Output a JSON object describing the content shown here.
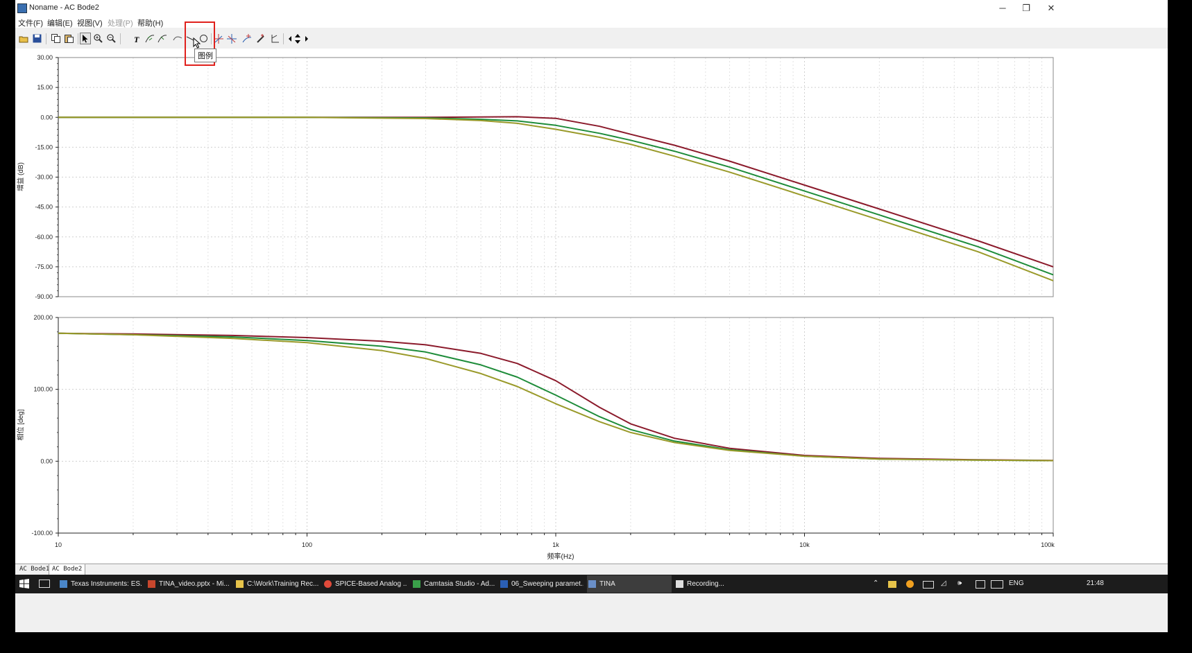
{
  "window": {
    "title": "Noname - AC Bode2",
    "controls": [
      "─",
      "❐",
      "✕"
    ]
  },
  "menu": [
    {
      "label": "文件(F)",
      "enabled": true
    },
    {
      "label": "编辑(E)",
      "enabled": true
    },
    {
      "label": "视图(V)",
      "enabled": true
    },
    {
      "label": "处理(P)",
      "enabled": false
    },
    {
      "label": "帮助(H)",
      "enabled": true
    }
  ],
  "toolbar": {
    "buttons": [
      "open-icon",
      "save-icon",
      "copy-icon",
      "paste-icon",
      "pointer-icon",
      "zoom-in-icon",
      "zoom-out-icon",
      "text-icon",
      "curve-label-icon",
      "curve-label-alt-icon",
      "legend-icon",
      "line-icon",
      "circle-icon",
      "cursor-a-icon",
      "cursor-b-icon",
      "marker-icon",
      "pen-icon",
      "axis-icon",
      "move-left-icon",
      "move-updown-icon",
      "move-right-icon"
    ],
    "tooltip": "图例"
  },
  "highlight_color": "#e0201c",
  "chart_data": [
    {
      "type": "line",
      "name": "gain",
      "ylabel": "增益 (dB)",
      "x_scale": "log",
      "xlim": [
        10,
        100000
      ],
      "ylim": [
        -90,
        30
      ],
      "yticks": [
        30,
        15,
        0,
        -15,
        -30,
        -45,
        -60,
        -75,
        -90
      ],
      "ytick_labels": [
        "30.00",
        "15.00",
        "0.00",
        "-15.00",
        "-30.00",
        "-45.00",
        "-60.00",
        "-75.00",
        "-90.00"
      ],
      "x": [
        10,
        100,
        300,
        500,
        700,
        1000,
        1500,
        2000,
        3000,
        5000,
        10000,
        20000,
        50000,
        100000
      ],
      "series": [
        {
          "color": "#8b1a2b",
          "values": [
            0,
            0,
            0,
            0.2,
            0.3,
            -0.5,
            -4.5,
            -8.5,
            -14,
            -22,
            -34,
            -46,
            -62,
            -75
          ]
        },
        {
          "color": "#1e8c3a",
          "values": [
            0,
            0,
            -0.3,
            -1,
            -1.8,
            -4,
            -8,
            -11.5,
            -17,
            -25,
            -37,
            -49,
            -65,
            -79
          ]
        },
        {
          "color": "#9a9a2a",
          "values": [
            0,
            0,
            -0.6,
            -1.6,
            -3,
            -6,
            -10,
            -13.5,
            -19.5,
            -27.5,
            -39.5,
            -51.5,
            -67.5,
            -82
          ]
        }
      ]
    },
    {
      "type": "line",
      "name": "phase",
      "ylabel": "相位 [deg]",
      "xlabel": "频率(Hz)",
      "x_scale": "log",
      "xlim": [
        10,
        100000
      ],
      "ylim": [
        -100,
        200
      ],
      "yticks": [
        200,
        100,
        0,
        -100
      ],
      "ytick_labels": [
        "200.00",
        "100.00",
        "0.00",
        "-100.00"
      ],
      "xticks": [
        10,
        100,
        1000,
        10000,
        100000
      ],
      "xtick_labels": [
        "10",
        "100",
        "1k",
        "10k",
        "100k"
      ],
      "x": [
        10,
        20,
        50,
        100,
        200,
        300,
        500,
        700,
        1000,
        1500,
        2000,
        3000,
        5000,
        10000,
        20000,
        50000,
        100000
      ],
      "series": [
        {
          "color": "#8b1a2b",
          "values": [
            178,
            177,
            175,
            172,
            167,
            162,
            150,
            136,
            112,
            75,
            52,
            32,
            18,
            8,
            4,
            2,
            1
          ]
        },
        {
          "color": "#1e8c3a",
          "values": [
            178,
            176,
            173,
            168,
            160,
            152,
            134,
            117,
            92,
            62,
            44,
            28,
            16,
            7,
            3,
            1.5,
            0.8
          ]
        },
        {
          "color": "#9a9a2a",
          "values": [
            178,
            176,
            171,
            165,
            154,
            143,
            122,
            104,
            80,
            55,
            40,
            26,
            15,
            7,
            3,
            1.5,
            0.8
          ]
        }
      ]
    }
  ],
  "tabs": [
    {
      "label": "AC Bode1",
      "active": false
    },
    {
      "label": "AC Bode2",
      "active": true
    }
  ],
  "taskbar": {
    "tasks": [
      {
        "label": "Texas Instruments: ES...",
        "color": "#4a86c8"
      },
      {
        "label": "TINA_video.pptx - Mi...",
        "color": "#c8472d"
      },
      {
        "label": "C:\\Work\\Training Rec...",
        "color": "#e6c34a"
      },
      {
        "label": "SPICE-Based Analog ...",
        "color": "#e04a3a"
      },
      {
        "label": "Camtasia Studio - Ad...",
        "color": "#3aa04a"
      },
      {
        "label": "06_Sweeping paramet...",
        "color": "#2b5fb4"
      },
      {
        "label": "TINA",
        "color": "#6a8fc8",
        "active": true
      },
      {
        "label": "Recording...",
        "color": "#dddddd"
      }
    ],
    "lang": "ENG",
    "time": "21:48"
  }
}
